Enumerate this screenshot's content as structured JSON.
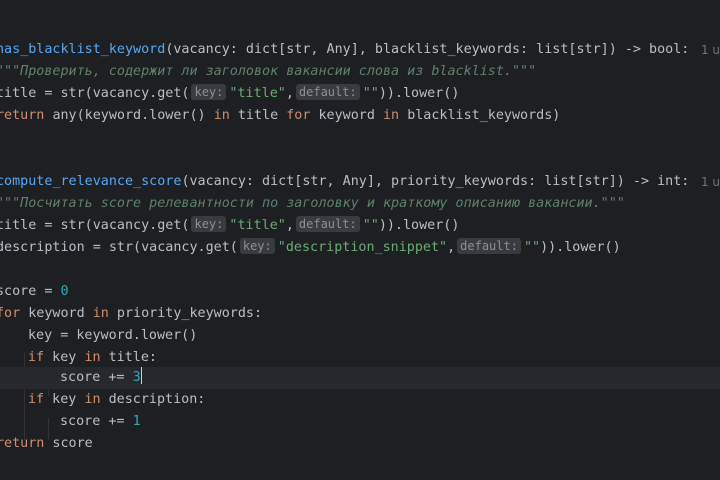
{
  "code": {
    "fn1": {
      "def_name": "has_blacklist_keyword",
      "params": "(vacancy: dict[str, Any], blacklist_keywords: list[str]) -> bool:",
      "usages": "1 u",
      "doc": "\"\"\"Проверить, содержит ли заголовок вакансии слова из blacklist.\"\"\"",
      "line2_a": "title = str(vacancy.get(",
      "line2_hint_key": "key:",
      "line2_str": "\"title\"",
      "line2_comma": ",",
      "line2_hint_default": "default:",
      "line2_empty": "\"\"",
      "line2_end": ")).lower()",
      "line3_return": "return",
      "line3_a": "any(keyword.lower()",
      "line3_in": "in",
      "line3_b": "title",
      "line3_for": "for",
      "line3_c": "keyword",
      "line3_in2": "in",
      "line3_d": "blacklist_keywords)"
    },
    "fn2": {
      "def_name": "compute_relevance_score",
      "params": "(vacancy: dict[str, Any], priority_keywords: list[str]) -> int:",
      "usages": "1 u",
      "doc": "\"\"\"Посчитать score релевантности по заголовку и краткому описанию вакансии.\"\"\"",
      "title_a": "title = str(vacancy.get(",
      "title_hint_key": "key:",
      "title_str": "\"title\"",
      "title_comma": ",",
      "title_hint_default": "default:",
      "title_empty": "\"\"",
      "title_end": ")).lower()",
      "desc_a": "description = str(vacancy.get(",
      "desc_hint_key": "key:",
      "desc_str": "\"description_snippet\"",
      "desc_comma": ",",
      "desc_hint_default": "default:",
      "desc_empty": "\"\"",
      "desc_end": ")).lower()",
      "score_init": "score = ",
      "score_zero": "0",
      "for_kw": "for",
      "for_a": " keyword ",
      "for_in": "in",
      "for_b": " priority_keywords:",
      "key_line": "key = keyword.lower()",
      "if1_kw": "if",
      "if1_a": " key ",
      "if1_in": "in",
      "if1_b": " title:",
      "inc1_a": "score += ",
      "inc1_num": "3",
      "if2_kw": "if",
      "if2_a": " key ",
      "if2_in": "in",
      "if2_b": " description:",
      "inc2_a": "score += ",
      "inc2_num": "1",
      "ret_kw": "return",
      "ret_a": " score"
    }
  },
  "colors": {
    "background": "#1e1f22",
    "current_line": "#26282e",
    "keyword": "#cf8e6d",
    "function": "#56a8f5",
    "string": "#6aab73",
    "number": "#2aacb8",
    "docstring": "#5f826b"
  }
}
